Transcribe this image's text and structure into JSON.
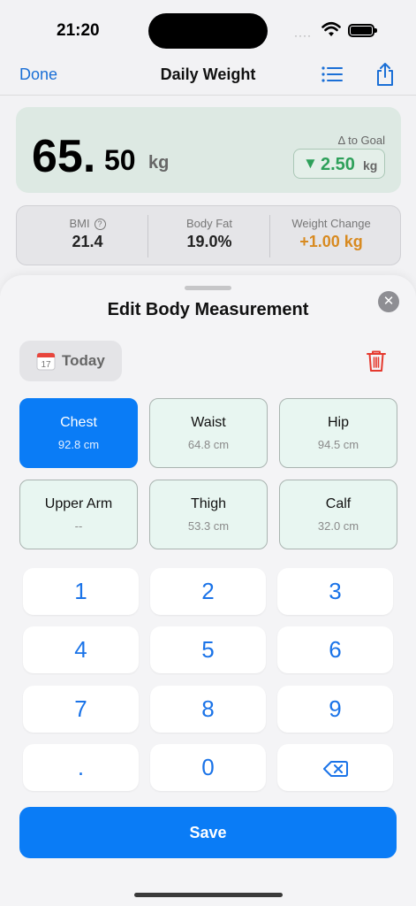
{
  "status_bar": {
    "time": "21:20",
    "signal": "····"
  },
  "nav": {
    "done": "Done",
    "title": "Daily Weight",
    "list_icon": "list-icon",
    "share_icon": "share-icon"
  },
  "weight_card": {
    "int_part": "65.",
    "dec_part": "50",
    "unit": "kg",
    "goal_label": "Δ to Goal",
    "goal_arrow": "▼",
    "goal_value": "2.50",
    "goal_unit": "kg",
    "bg_color": "#dde9e3",
    "goal_color": "#2ea05a"
  },
  "stats": [
    {
      "label": "BMI",
      "value": "21.4",
      "help": "?"
    },
    {
      "label": "Body Fat",
      "value": "19.0%"
    },
    {
      "label": "Weight Change",
      "value": "+1.00 kg",
      "color": "#d88a20"
    }
  ],
  "sheet": {
    "title": "Edit Body Measurement",
    "close": "✕",
    "date_label": "Today",
    "calendar_day": "17",
    "measurements": [
      {
        "name": "Chest",
        "value": "92.8 cm",
        "selected": true
      },
      {
        "name": "Waist",
        "value": "64.8 cm",
        "selected": false
      },
      {
        "name": "Hip",
        "value": "94.5 cm",
        "selected": false
      },
      {
        "name": "Upper Arm",
        "value": "--",
        "selected": false
      },
      {
        "name": "Thigh",
        "value": "53.3 cm",
        "selected": false
      },
      {
        "name": "Calf",
        "value": "32.0 cm",
        "selected": false
      }
    ],
    "keypad": [
      "1",
      "2",
      "3",
      "4",
      "5",
      "6",
      "7",
      "8",
      "9",
      ".",
      "0",
      "⌫"
    ],
    "save": "Save",
    "accent": "#0a7cf6"
  }
}
